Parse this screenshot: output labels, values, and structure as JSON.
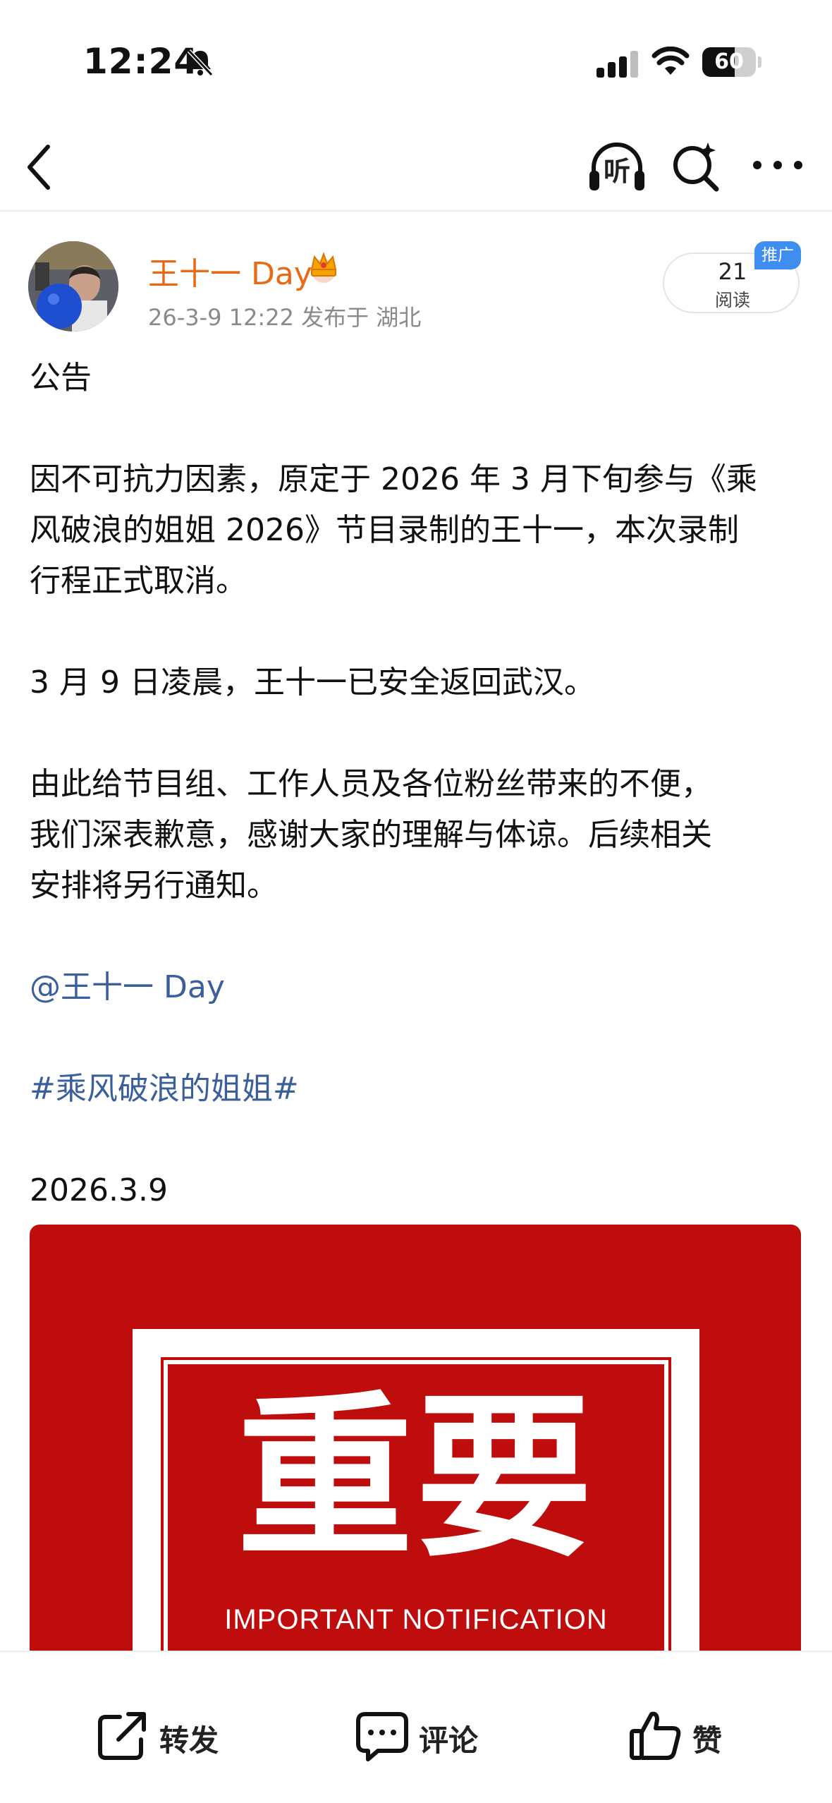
{
  "status_bar": {
    "time": "12:24",
    "battery_level": "60",
    "battery_percent": 60
  },
  "nav": {
    "listen_label": "听"
  },
  "author": {
    "name": "王十一 Day",
    "meta": "26-3-9 12:22  发布于 湖北",
    "read_count": "21",
    "read_label": "阅读",
    "promo_badge": "推广"
  },
  "post": {
    "paragraphs": [
      "公告",
      "因不可抗力因素，原定于 2026 年 3 月下旬参与《乘",
      "风破浪的姐姐 2026》节目录制的王十一，本次录制",
      "行程正式取消。",
      "3 月 9 日凌晨，王十一已安全返回武汉。",
      "由此给节目组、工作人员及各位粉丝带来的不便，",
      "我们深表歉意，感谢大家的理解与体谅。后续相关",
      "安排将另行通知。",
      "@王十一 Day",
      "#乘风破浪的姐姐#",
      "2026.3.9"
    ],
    "image": {
      "title": "重要",
      "subtitle": "IMPORTANT NOTIFICATION"
    }
  },
  "actions": {
    "repost": "转发",
    "comment": "评论",
    "like": "赞"
  },
  "colors": {
    "author_name": "#e86a17",
    "link": "#3a5f9a",
    "image_red": "#bf0d0e",
    "promo_blue": "#3d8ef0"
  },
  "icons": [
    "bell-muted-icon",
    "signal-icon",
    "wifi-icon",
    "back-icon",
    "headphones-icon",
    "search-star-icon",
    "more-icon",
    "crown-icon",
    "share-icon",
    "comment-icon",
    "thumbs-up-icon"
  ]
}
